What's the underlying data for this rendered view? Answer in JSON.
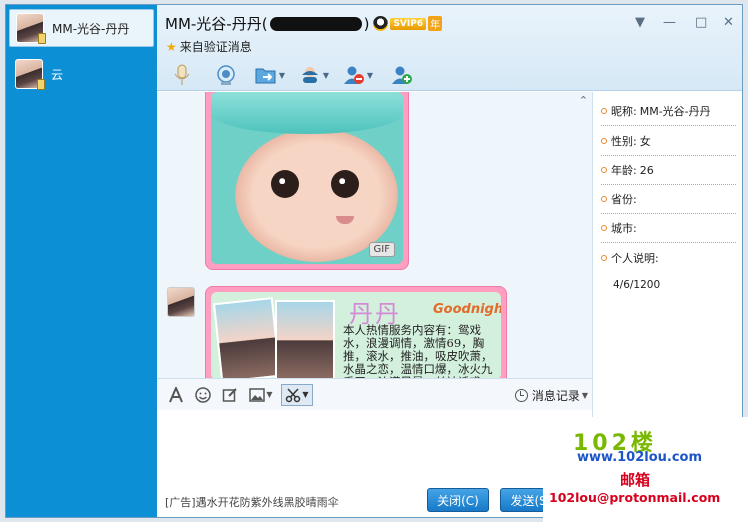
{
  "contacts": [
    {
      "name": "MM-光谷-丹丹",
      "selected": true
    },
    {
      "name": "云",
      "selected": false
    }
  ],
  "header": {
    "title": "MM-光谷-丹丹",
    "title_paren_open": "(",
    "title_paren_close": ")",
    "vip_label": "SVIP6",
    "year_label": "年",
    "subtitle": "来自验证消息"
  },
  "window_controls": {
    "menu": "▼",
    "minimize": "—",
    "maximize": "□",
    "close": "✕"
  },
  "toolbar": {
    "icons": [
      "microphone-icon",
      "video-icon",
      "file-transfer-icon",
      "remote-assist-icon",
      "block-user-icon",
      "add-user-icon"
    ]
  },
  "chat": {
    "gif_badge": "GIF",
    "card_title": "丹丹",
    "card_goodnight": "Goodnight",
    "card_text": "本人热情服务内容有：鸳戏水，浪漫调情，激情69，胸推，滚水，推油，吸皮吹萧，水晶之恋，温情口爆，冰火九重天，沙漠风暴，丝袜诱惑，"
  },
  "input_toolbar": {
    "icons": [
      "font-icon",
      "emoji-icon",
      "edit-icon",
      "image-icon",
      "screenshot-icon"
    ],
    "history_label": "消息记录"
  },
  "input_area": {
    "ad_text": "[广告]遇水开花防紫外线黑胶晴雨伞",
    "close_button": "关闭(C)",
    "send_button": "发送(S)"
  },
  "info_panel": {
    "rows": [
      {
        "label": "昵称:",
        "value": "MM-光谷-丹丹"
      },
      {
        "label": "性别:",
        "value": "女"
      },
      {
        "label": "年龄:",
        "value": "26"
      },
      {
        "label": "省份:",
        "value": ""
      },
      {
        "label": "城市:",
        "value": ""
      },
      {
        "label": "个人说明:",
        "value": ""
      }
    ],
    "date": "4/6/1200"
  },
  "watermark": {
    "logo": "102楼",
    "url": "www.102lou.com",
    "mailbox": "邮箱",
    "email": "102lou@protonmail.com"
  },
  "colors": {
    "sidebar": "#0d8fd6",
    "bubble": "#ff9ec0",
    "button": "#1779c8",
    "wm_red": "#d7001d",
    "wm_green": "#79b800"
  }
}
